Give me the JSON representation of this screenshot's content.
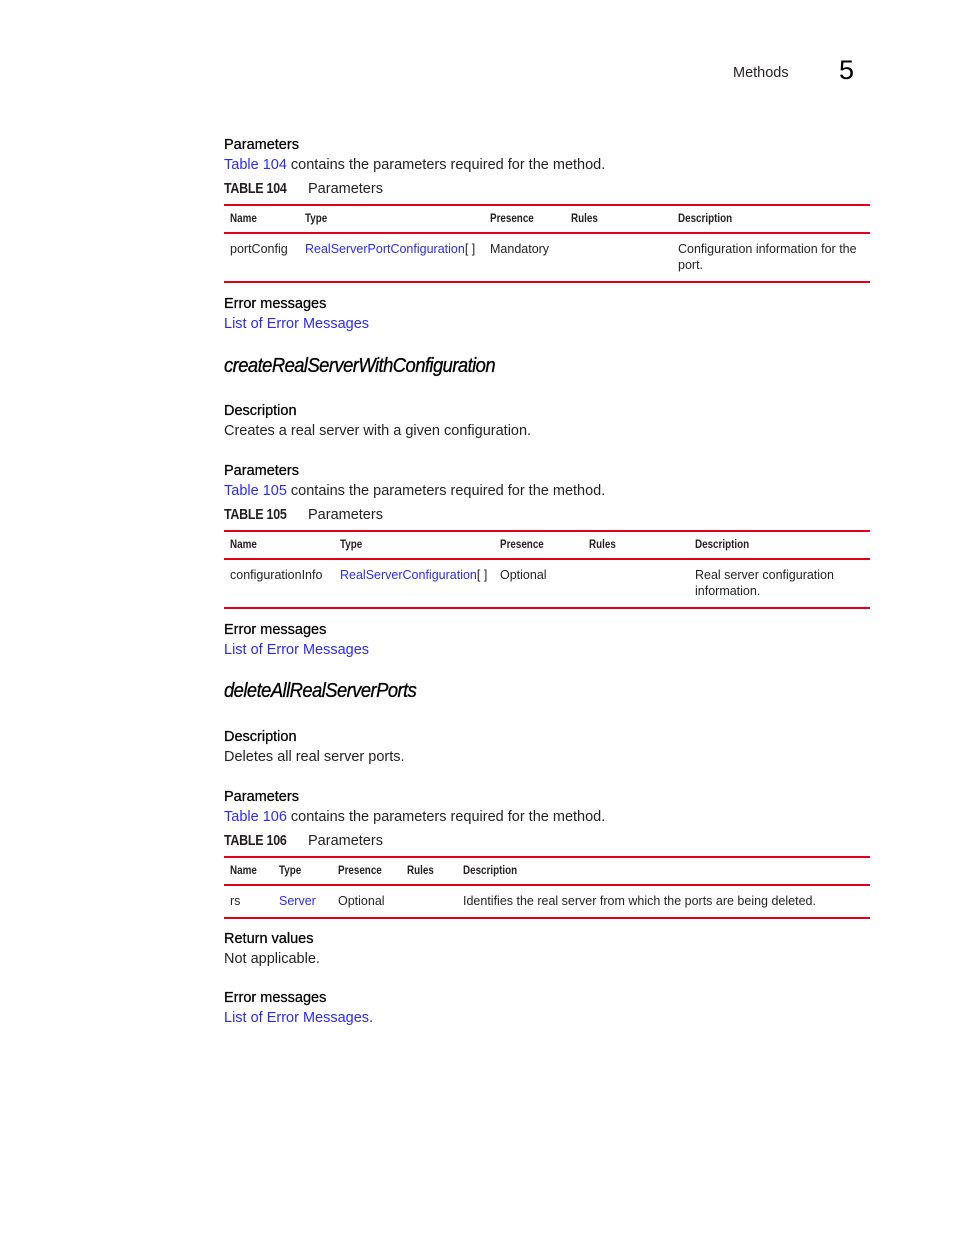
{
  "header": {
    "section": "Methods",
    "chapter": "5"
  },
  "sections": {
    "s1": {
      "params_heading": "Parameters",
      "params_link": "Table 104",
      "params_text": " contains the parameters required for the method.",
      "table_num": "TABLE 104",
      "table_title": "Parameters",
      "columns": [
        "Name",
        "Type",
        "Presence",
        "Rules",
        "Description"
      ],
      "rows": [
        {
          "name": "portConfig",
          "type_link": "RealServerPortConfiguration",
          "type_suffix": "[ ]",
          "presence": "Mandatory",
          "rules": "",
          "description": "Configuration information for the port."
        }
      ],
      "errors_heading": "Error messages",
      "errors_link": "List of Error Messages"
    },
    "s2": {
      "title": "createRealServerWithConfiguration",
      "desc_heading": "Description",
      "desc_text": "Creates a real server with a given configuration.",
      "params_heading": "Parameters",
      "params_link": "Table 105",
      "params_text": " contains the parameters required for the method.",
      "table_num": "TABLE 105",
      "table_title": "Parameters",
      "columns": [
        "Name",
        "Type",
        "Presence",
        "Rules",
        "Description"
      ],
      "rows": [
        {
          "name": "configurationInfo",
          "type_link": "RealServerConfiguration",
          "type_suffix": "[ ]",
          "presence": "Optional",
          "rules": "",
          "description": "Real server configuration information."
        }
      ],
      "errors_heading": "Error messages",
      "errors_link": "List of Error Messages"
    },
    "s3": {
      "title": "deleteAllRealServerPorts",
      "desc_heading": "Description",
      "desc_text": "Deletes all real server ports.",
      "params_heading": "Parameters",
      "params_link": "Table 106",
      "params_text": " contains the parameters required for the method.",
      "table_num": "TABLE 106",
      "table_title": "Parameters",
      "columns": [
        "Name",
        "Type",
        "Presence",
        "Rules",
        "Description"
      ],
      "rows": [
        {
          "name": "rs",
          "type_link": "Server",
          "type_suffix": "",
          "presence": "Optional",
          "rules": "",
          "description": "Identifies the real server from which the ports are being deleted."
        }
      ],
      "return_heading": "Return values",
      "return_text": "Not applicable.",
      "errors_heading": "Error messages",
      "errors_link": "List of Error Messages",
      "errors_suffix": "."
    }
  }
}
